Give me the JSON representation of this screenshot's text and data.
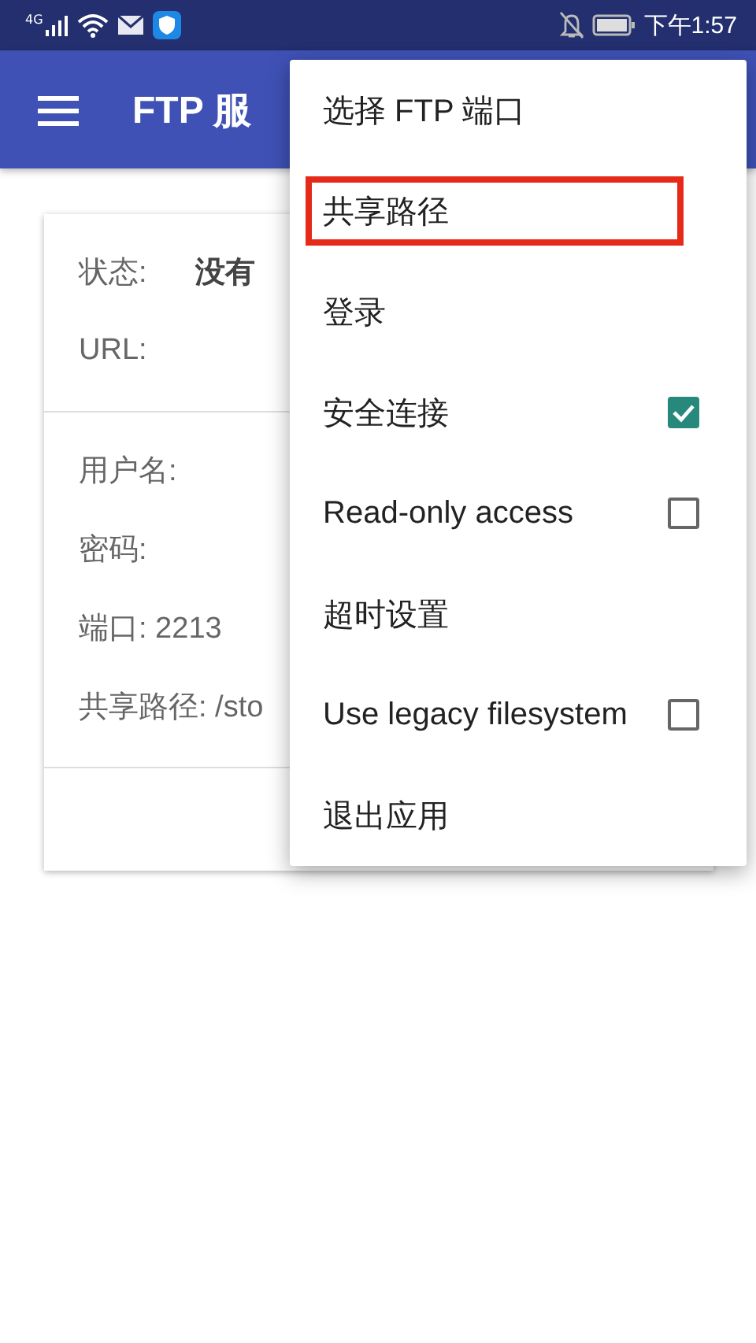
{
  "status_bar": {
    "network": "4G",
    "time": "下午1:57"
  },
  "app_bar": {
    "title": "FTP 服"
  },
  "card": {
    "sections": [
      {
        "rows": [
          {
            "label": "状态:",
            "value": "没有"
          },
          {
            "label": "URL:"
          }
        ]
      },
      {
        "rows": [
          {
            "label": "用户名:"
          },
          {
            "label": "密码:"
          },
          {
            "label": "端口: 2213"
          },
          {
            "label": "共享路径: /sto"
          }
        ]
      }
    ]
  },
  "menu": {
    "items": [
      {
        "kind": "plain",
        "label": "选择 FTP 端口",
        "highlighted": false
      },
      {
        "kind": "plain",
        "label": "共享路径",
        "highlighted": true
      },
      {
        "kind": "plain",
        "label": "登录",
        "highlighted": false
      },
      {
        "kind": "checkbox",
        "label": "安全连接",
        "checked": true,
        "highlighted": false
      },
      {
        "kind": "checkbox",
        "label": "Read-only access",
        "checked": false,
        "highlighted": false
      },
      {
        "kind": "plain",
        "label": "超时设置",
        "highlighted": false
      },
      {
        "kind": "checkbox",
        "label": "Use legacy filesystem",
        "checked": false,
        "highlighted": false
      },
      {
        "kind": "plain",
        "label": "退出应用",
        "highlighted": false
      }
    ]
  }
}
